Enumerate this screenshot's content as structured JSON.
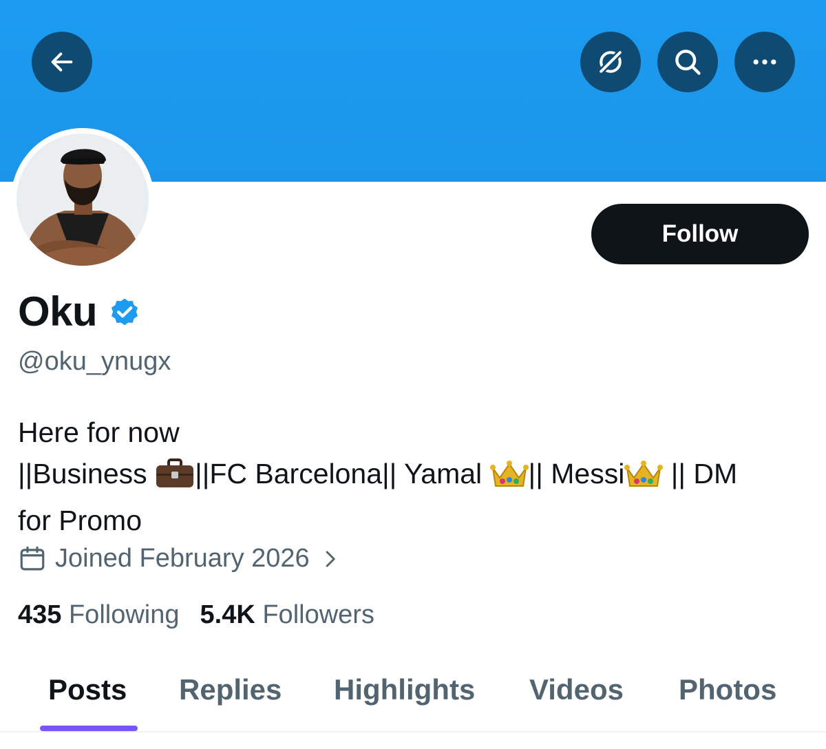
{
  "header": {
    "back_icon": "arrow-left-icon",
    "grok_icon": "grok-icon",
    "search_icon": "search-icon",
    "more_icon": "more-dots-icon",
    "banner_color": "#1d9bf0",
    "button_color": "#0f4a72"
  },
  "profile": {
    "display_name": "Oku",
    "verified": true,
    "verified_color": "#1d9bf0",
    "handle": "@oku_ynugx",
    "follow_label": "Follow",
    "bio_line1": "Here for now",
    "bio_seg1": "||Business ",
    "bio_seg2": "||FC Barcelona|| Yamal ",
    "bio_seg3": "|| Messi",
    "bio_seg4": " || DM",
    "bio_line3": "for Promo",
    "joined": "Joined February 2026"
  },
  "stats": {
    "following_count": "435",
    "following_label": "Following",
    "followers_count": "5.4K",
    "followers_label": "Followers"
  },
  "tabs": [
    {
      "label": "Posts",
      "active": true
    },
    {
      "label": "Replies",
      "active": false
    },
    {
      "label": "Highlights",
      "active": false
    },
    {
      "label": "Videos",
      "active": false
    },
    {
      "label": "Photos",
      "active": false
    }
  ],
  "accent_color": "#7856ff"
}
